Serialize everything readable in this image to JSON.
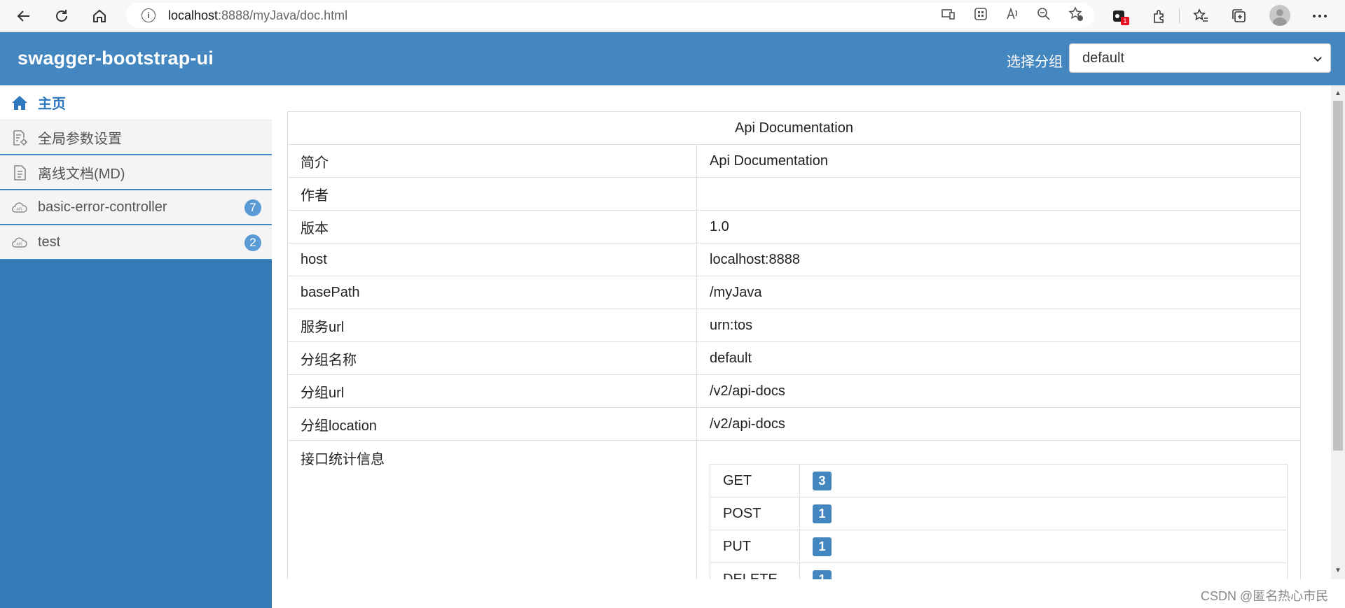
{
  "browser": {
    "back_icon": "back-arrow-icon",
    "refresh_icon": "refresh-icon",
    "home_icon": "home-icon",
    "url_host": "localhost",
    "url_rest": ":8888/myJava/doc.html",
    "extension_badge": "1"
  },
  "header": {
    "title": "swagger-bootstrap-ui",
    "group_label": "选择分组",
    "group_value": "default",
    "background": "#4486bf"
  },
  "sidebar": {
    "items": [
      {
        "label": "主页",
        "icon": "home-icon",
        "active": true
      },
      {
        "label": "全局参数设置",
        "icon": "settings-doc-icon"
      },
      {
        "label": "离线文档(MD)",
        "icon": "document-icon"
      },
      {
        "label": "basic-error-controller",
        "icon": "api-cloud-icon",
        "badge": "7"
      },
      {
        "label": "test",
        "icon": "api-cloud-icon",
        "badge": "2"
      }
    ]
  },
  "doc": {
    "title": "Api Documentation",
    "rows": [
      {
        "key": "简介",
        "value": "Api Documentation"
      },
      {
        "key": "作者",
        "value": ""
      },
      {
        "key": "版本",
        "value": "1.0"
      },
      {
        "key": "host",
        "value": "localhost:8888"
      },
      {
        "key": "basePath",
        "value": "/myJava"
      },
      {
        "key": "服务url",
        "value": "urn:tos"
      },
      {
        "key": "分组名称",
        "value": "default"
      },
      {
        "key": "分组url",
        "value": "/v2/api-docs"
      },
      {
        "key": "分组location",
        "value": "/v2/api-docs"
      }
    ],
    "stats_key": "接口统计信息",
    "stats": [
      {
        "method": "GET",
        "count": "3"
      },
      {
        "method": "POST",
        "count": "1"
      },
      {
        "method": "PUT",
        "count": "1"
      },
      {
        "method": "DELETE",
        "count": "1"
      }
    ]
  },
  "watermark": "CSDN @匿名热心市民"
}
